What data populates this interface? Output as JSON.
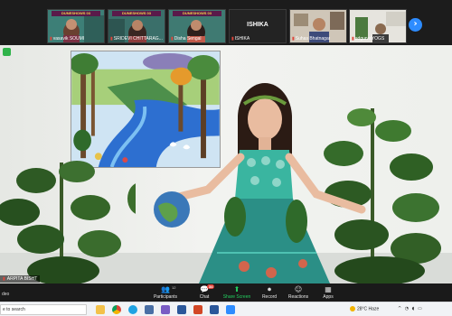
{
  "app": {
    "title": "Zoom Meeting"
  },
  "participants_strip": {
    "thumbnails": [
      {
        "banner": "DUNESHOWS 03",
        "name": "vasavik SOUMI"
      },
      {
        "banner": "DUNESHOWS 03",
        "name": "SRIDEVI CHITTARAG..."
      },
      {
        "banner": "DUNESHOWS 03",
        "name": "Disha Sengal"
      },
      {
        "name": "ISHIKA"
      },
      {
        "name": "Suhas Bhatnagar"
      },
      {
        "name": "adgurvaYOGS"
      }
    ],
    "next_icon": "chevron-right-icon"
  },
  "main_video": {
    "participant_name": "ARPITA BISHT",
    "recording_label": "",
    "security_icon": "shield-icon"
  },
  "toolbar": {
    "left_label": "deo",
    "participant_count": "12",
    "items": [
      {
        "label": "Participants",
        "icon": "participants-icon"
      },
      {
        "label": "Chat",
        "icon": "chat-icon",
        "badge": "34"
      },
      {
        "label": "Share Screen",
        "icon": "share-screen-icon"
      },
      {
        "label": "Record",
        "icon": "record-icon"
      },
      {
        "label": "Reactions",
        "icon": "reactions-icon"
      },
      {
        "label": "Apps",
        "icon": "apps-icon"
      }
    ]
  },
  "taskbar": {
    "search_placeholder": "e to search",
    "weather": "28°C  Haze",
    "apps": [
      "files-icon",
      "chrome-icon",
      "edge-icon",
      "mail-icon",
      "store-icon",
      "video-icon",
      "powerpoint-icon",
      "word-icon",
      "zoom-icon"
    ]
  },
  "colors": {
    "accent": "#2d8cff",
    "share_green": "#23d160",
    "badge_red": "#e0443a"
  }
}
